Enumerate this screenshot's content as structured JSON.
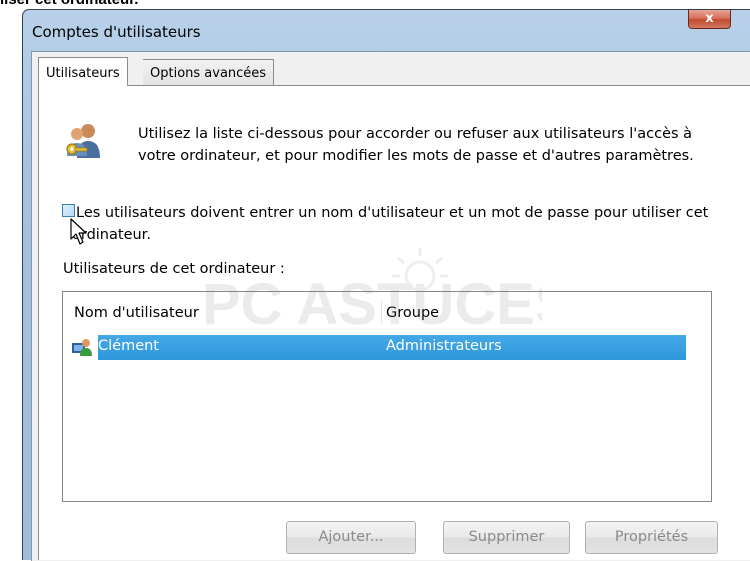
{
  "page": {
    "caption": "liser cet ordinateur."
  },
  "window": {
    "title": "Comptes d'utilisateurs",
    "close_glyph": "x"
  },
  "tabs": [
    {
      "label": "Utilisateurs",
      "active": true
    },
    {
      "label": "Options avancées",
      "active": false
    }
  ],
  "intro": {
    "icon": "users-keys-icon",
    "text": "Utilisez la liste ci-dessous pour accorder ou refuser aux utilisateurs l'accès à votre ordinateur, et pour modifier les mots de passe et d'autres paramètres."
  },
  "require_login": {
    "checked": false,
    "label": "Les utilisateurs doivent entrer un nom d'utilisateur et un mot de passe pour utiliser cet ordinateur."
  },
  "users_list": {
    "heading": "Utilisateurs de cet ordinateur :",
    "columns": [
      "Nom d'utilisateur",
      "Groupe"
    ],
    "rows": [
      {
        "name": "Clément",
        "group": "Administrateurs",
        "selected": true,
        "icon": "user-icon"
      }
    ]
  },
  "buttons": {
    "add": "Ajouter...",
    "remove": "Supprimer",
    "properties": "Propriétés"
  },
  "watermark": {
    "text": "PC ASTUCES"
  },
  "colors": {
    "selection": "#3399dd",
    "title_bar": "#b9d1ea",
    "close_button": "#c24a2e"
  }
}
